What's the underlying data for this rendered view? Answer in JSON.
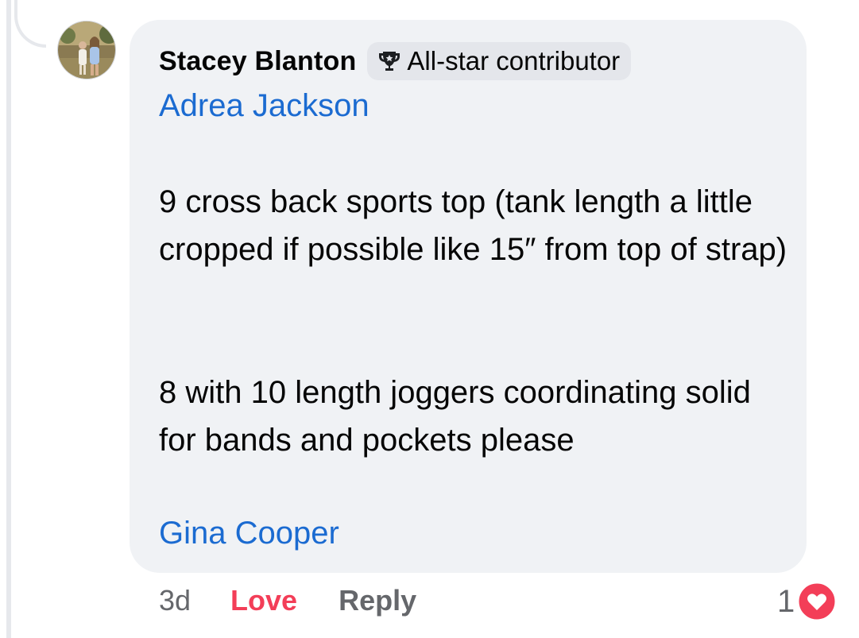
{
  "comment": {
    "author": "Stacey Blanton",
    "badge": {
      "icon": "trophy-icon",
      "label": "All-star contributor"
    },
    "mention_top": "Adrea Jackson",
    "paragraphs": [
      "9 cross back sports top (tank length a little cropped if possible like 15″ from top of strap)",
      "8 with 10 length joggers coordinating solid for bands and pockets please"
    ],
    "mention_bottom": "Gina Cooper"
  },
  "actions": {
    "time": "3d",
    "love_label": "Love",
    "reply_label": "Reply"
  },
  "reaction": {
    "count": "1",
    "icon": "heart-reaction-icon",
    "color": "#f33e58"
  },
  "colors": {
    "bubble": "#f0f2f5",
    "mention": "#1b6bd1",
    "love": "#f33e58",
    "muted": "#65676b"
  }
}
